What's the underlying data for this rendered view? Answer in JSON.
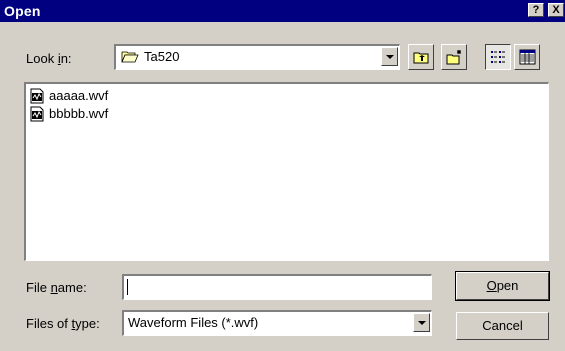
{
  "window": {
    "title": "Open",
    "help_label": "?",
    "close_label": "X"
  },
  "lookin": {
    "label_pre": "Look ",
    "label_accel": "i",
    "label_post": "n:",
    "value": "Ta520"
  },
  "toolbar": {
    "buttons": [
      "up-one-level",
      "create-new-folder",
      "list-view",
      "details-view"
    ]
  },
  "files": [
    {
      "name": "aaaaa.wvf",
      "icon": "waveform-file-icon"
    },
    {
      "name": "bbbbb.wvf",
      "icon": "waveform-file-icon"
    }
  ],
  "filename": {
    "label_pre": "File ",
    "label_accel": "n",
    "label_post": "ame:",
    "value": ""
  },
  "filetype": {
    "label_pre": "Files of ",
    "label_accel": "t",
    "label_post": "ype:",
    "value": "Waveform Files (*.wvf)"
  },
  "buttons": {
    "open_accel": "O",
    "open_post": "pen",
    "cancel": "Cancel"
  },
  "colors": {
    "titlebar": "#000080",
    "face": "#d4d0c8"
  }
}
